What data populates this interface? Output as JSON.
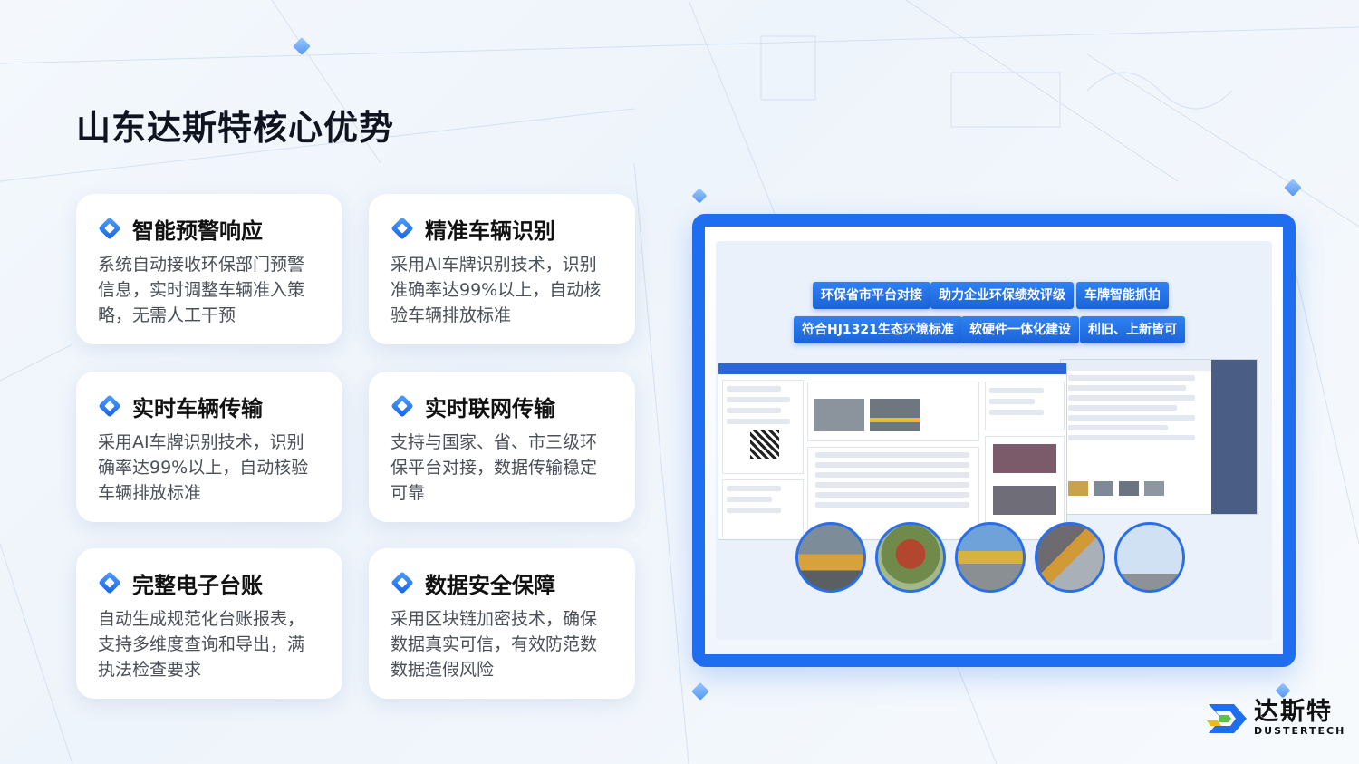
{
  "page": {
    "title": "山东达斯特核心优势"
  },
  "cards": [
    {
      "icon": "diamond-icon",
      "title": "智能预警响应",
      "text": "系统自动接收环保部门预警信息，实时调整车辆准入策略，无需人工干预"
    },
    {
      "icon": "diamond-icon",
      "title": "精准车辆识别",
      "text": "采用AI车牌识别技术，识别准确率达99%以上，自动核验车辆排放标准"
    },
    {
      "icon": "diamond-icon",
      "title": "实时车辆传输",
      "text": "采用AI车牌识别技术，识别确率达99%以上，自动核验车辆排放标准"
    },
    {
      "icon": "diamond-icon",
      "title": "实时联网传输",
      "text": "支持与国家、省、市三级环保平台对接，数据传输稳定可靠"
    },
    {
      "icon": "diamond-icon",
      "title": "完整电子台账",
      "text": "自动生成规范化台账报表，支持多维度查询和导出，满执法检查要求"
    },
    {
      "icon": "diamond-icon",
      "title": "数据安全保障",
      "text": "采用区块链加密技术，确保数据真实可信，有效防范数数据造假风险"
    }
  ],
  "showcase": {
    "tags_row1": [
      "环保省市平台对接",
      "助力企业环保绩效评级",
      "车牌智能抓拍"
    ],
    "tags_row2": [
      "符合HJ1321生态环境标准",
      "软硬件一体化建设",
      "利旧、上新皆可"
    ]
  },
  "logo": {
    "cn": "达斯特",
    "en": "DUSTERTECH",
    "colors": {
      "blue": "#1f6ef0",
      "green": "#5cc34a",
      "yellow": "#f2b81b"
    }
  },
  "colors": {
    "accent": "#1f6ef0",
    "title": "#0f1420",
    "body_text": "#4a4f58"
  }
}
